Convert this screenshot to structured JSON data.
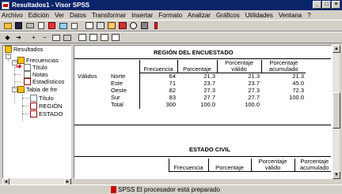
{
  "window": {
    "title": "Resultados1 - Visor SPSS"
  },
  "menu": [
    "Archivo",
    "Edición",
    "Ver",
    "Datos",
    "Transformar",
    "Insertar",
    "Formato",
    "Analizar",
    "Gráficos",
    "Utilidades",
    "Ventana",
    "?"
  ],
  "tree": {
    "root": "Resultados",
    "frecuencias": "Frecuencias",
    "titulo": "Título",
    "notas": "Notas",
    "estadisticos": "Estadísticos",
    "tabla": "Tabla de fre",
    "titulo2": "Título",
    "region": "REGIÓN",
    "estado": "ESTADO"
  },
  "table1": {
    "title": "REGIÓN DEL ENCUESTADO",
    "headers": [
      "Frecuencia",
      "Porcentaje",
      "Porcentaje válido",
      "Porcentaje acumulado"
    ],
    "group": "Válidos",
    "rows": [
      {
        "label": "Norte",
        "freq": "64",
        "pct": "21.3",
        "valid": "21.3",
        "cum": "21.3"
      },
      {
        "label": "Este",
        "freq": "71",
        "pct": "23.7",
        "valid": "23.7",
        "cum": "45.0"
      },
      {
        "label": "Oeste",
        "freq": "82",
        "pct": "27.3",
        "valid": "27.3",
        "cum": "72.3"
      },
      {
        "label": "Sur",
        "freq": "83",
        "pct": "27.7",
        "valid": "27.7",
        "cum": "100.0"
      },
      {
        "label": "Total",
        "freq": "300",
        "pct": "100.0",
        "valid": "100.0",
        "cum": ""
      }
    ]
  },
  "table2": {
    "title": "ESTADO CIVIL",
    "headers": [
      "Frecuencia",
      "Porcentaje",
      "Porcentaje válido",
      "Porcentaje acumulado"
    ]
  },
  "status": {
    "text": "SPSS El procesador está preparado"
  }
}
